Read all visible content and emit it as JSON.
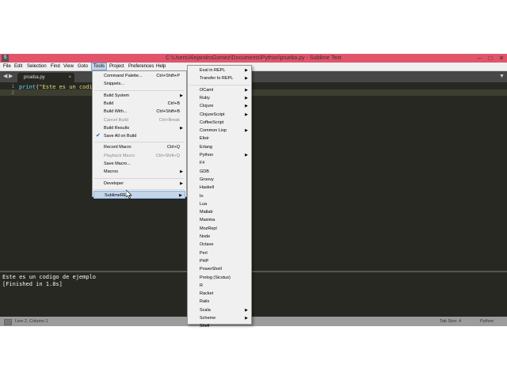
{
  "window": {
    "title": "C:\\Users\\AlejandroGomez\\Documents\\Python\\prueba.py - Sublime Text",
    "minimize": "–",
    "maximize": "□",
    "close": "✕"
  },
  "menubar": [
    "File",
    "Edit",
    "Selection",
    "Find",
    "View",
    "Goto",
    "Tools",
    "Project",
    "Preferences",
    "Help"
  ],
  "tab": {
    "label": "prueba.py",
    "close": "×"
  },
  "editor": {
    "line_numbers": [
      "1",
      "2"
    ],
    "code": {
      "fn": "print",
      "open": "(",
      "str": "\"Este es un codigo",
      "close": ""
    }
  },
  "console": {
    "lines": [
      "Este es un codigo de ejemplo",
      "[Finished in 1.8s]"
    ]
  },
  "statusbar": {
    "position": "Line 2, Column 1",
    "tab_size": "Tab Size: 4",
    "syntax": "Python"
  },
  "tools_menu": [
    {
      "label": "Command Palette...",
      "shortcut": "Ctrl+Shift+P"
    },
    {
      "label": "Snippets...",
      "shortcut": ""
    },
    {
      "sep": true
    },
    {
      "label": "Build System",
      "shortcut": "",
      "arrow": true
    },
    {
      "label": "Build",
      "shortcut": "Ctrl+B"
    },
    {
      "label": "Build With...",
      "shortcut": "Ctrl+Shift+B"
    },
    {
      "label": "Cancel Build",
      "shortcut": "Ctrl+Break",
      "disabled": true
    },
    {
      "label": "Build Results",
      "shortcut": "",
      "arrow": true
    },
    {
      "label": "Save All on Build",
      "shortcut": "",
      "checked": true
    },
    {
      "sep": true
    },
    {
      "label": "Record Macro",
      "shortcut": "Ctrl+Q"
    },
    {
      "label": "Playback Macro",
      "shortcut": "Ctrl+Shift+Q",
      "disabled": true
    },
    {
      "label": "Save Macro...",
      "shortcut": ""
    },
    {
      "label": "Macros",
      "shortcut": "",
      "arrow": true
    },
    {
      "sep": true
    },
    {
      "label": "Developer",
      "shortcut": "",
      "arrow": true
    },
    {
      "sep": true
    },
    {
      "label": "SublimeREPL",
      "shortcut": "",
      "arrow": true,
      "highlight": true
    }
  ],
  "repl_menu": [
    {
      "label": "Eval in REPL",
      "arrow": true
    },
    {
      "label": "Transfer to REPL",
      "arrow": true
    },
    {
      "sep": true
    },
    {
      "label": "OCaml",
      "arrow": true
    },
    {
      "label": "Ruby",
      "arrow": true
    },
    {
      "label": "Clojure",
      "arrow": true
    },
    {
      "label": "ClojureScript",
      "arrow": true
    },
    {
      "label": "CoffeeScript"
    },
    {
      "label": "Common Lisp",
      "arrow": true
    },
    {
      "label": "Elixir"
    },
    {
      "label": "Erlang"
    },
    {
      "label": "Python",
      "arrow": true
    },
    {
      "label": "F#"
    },
    {
      "label": "GDB"
    },
    {
      "label": "Groovy"
    },
    {
      "label": "Haskell"
    },
    {
      "label": "Io"
    },
    {
      "label": "Lua"
    },
    {
      "label": "Matlab"
    },
    {
      "label": "Maxima"
    },
    {
      "label": "MozRepl"
    },
    {
      "label": "Node"
    },
    {
      "label": "Octave"
    },
    {
      "label": "Perl"
    },
    {
      "label": "PHP"
    },
    {
      "label": "PowerShell"
    },
    {
      "label": "Prolog (Sicstus)"
    },
    {
      "label": "R"
    },
    {
      "label": "Racket"
    },
    {
      "label": "Rails"
    },
    {
      "label": "Scala",
      "arrow": true
    },
    {
      "label": "Scheme",
      "arrow": true
    },
    {
      "label": "Shell"
    }
  ],
  "colors": {
    "editor_bg": "#272822",
    "title_bg": "#e2546a",
    "keyword": "#66d9ef",
    "string": "#e6db74",
    "menu_hl": "#c4d5ea"
  }
}
